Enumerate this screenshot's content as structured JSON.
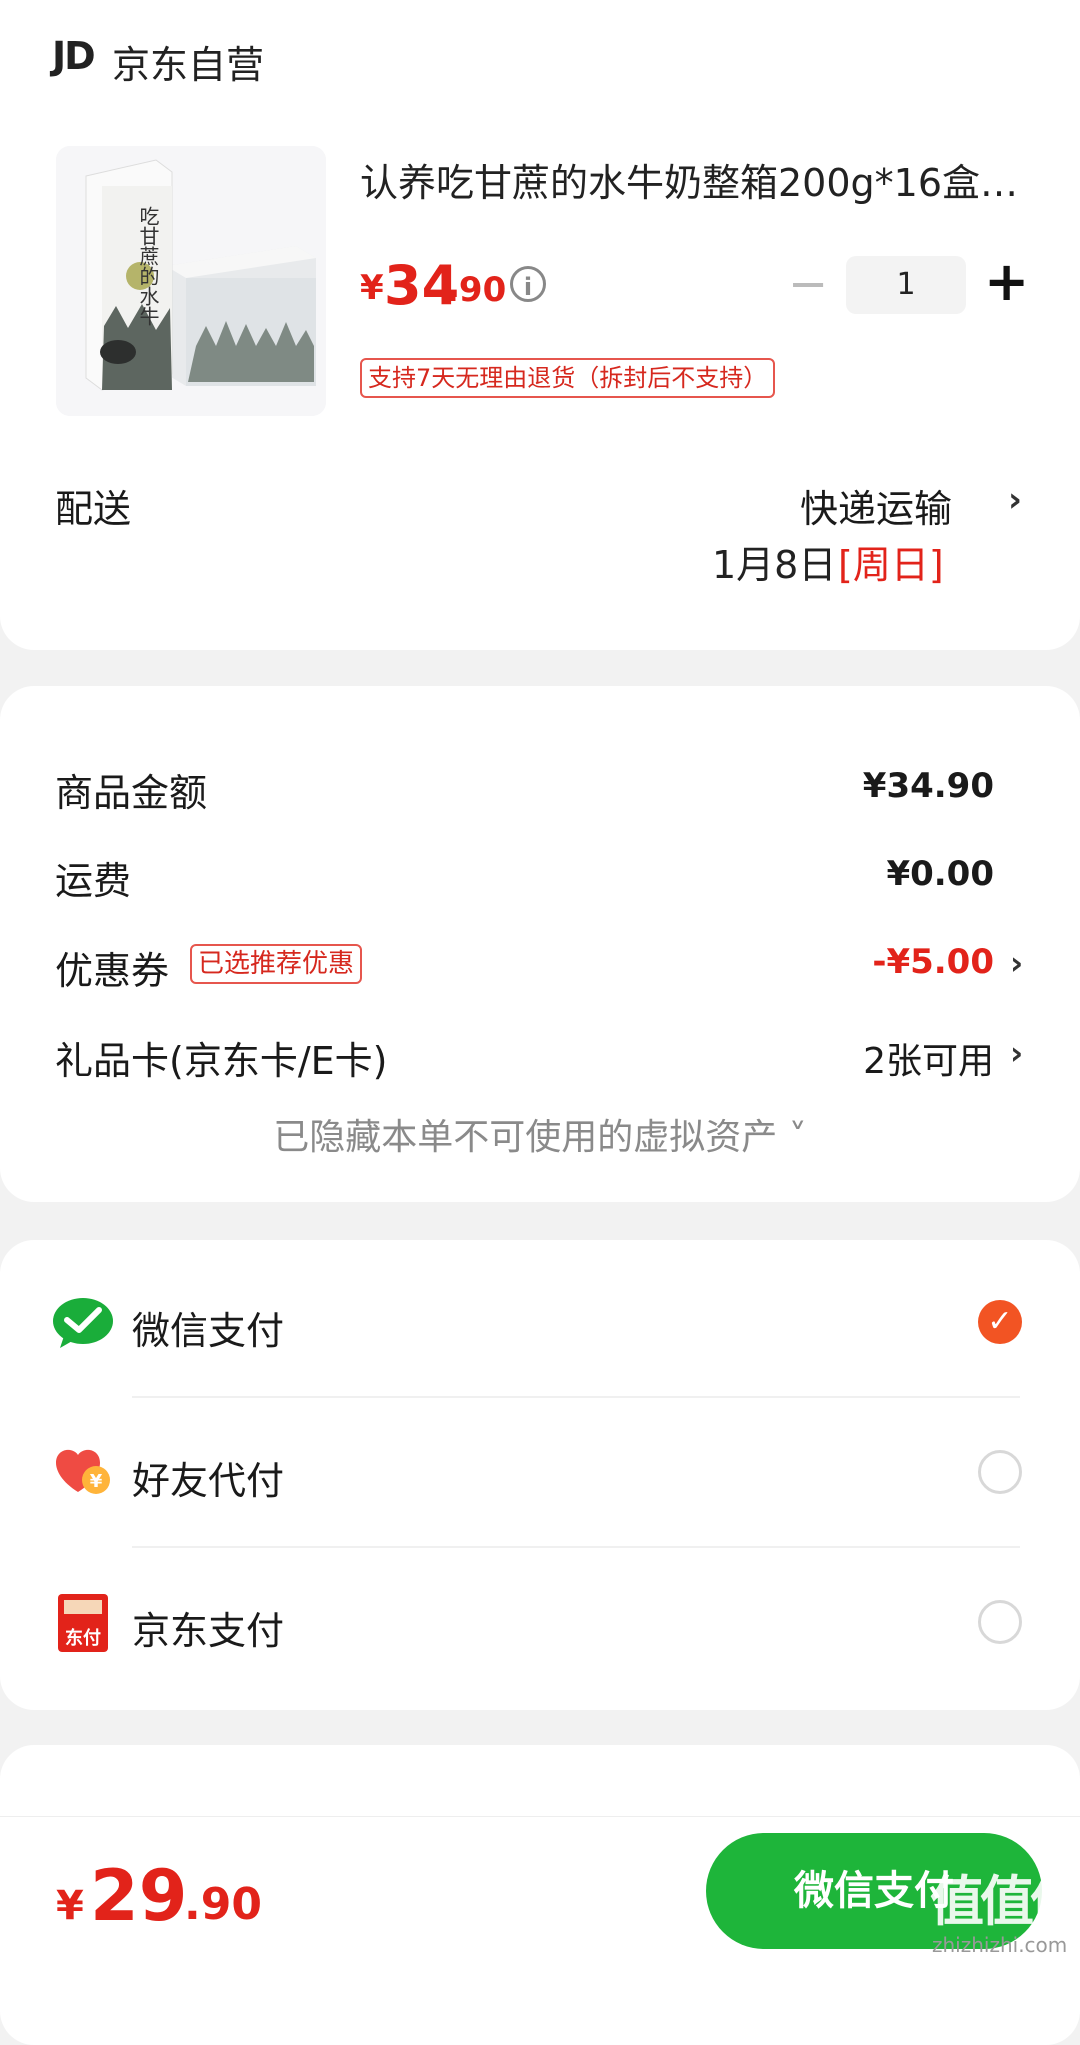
{
  "store": {
    "logo": "JD",
    "name": "京东自营"
  },
  "product": {
    "title": "认养吃甘蔗的水牛奶整箱200g*16盒…",
    "price_currency": "¥",
    "price_int": "34",
    "price_dec": ".90",
    "quantity": "1",
    "minus": "−",
    "plus": "+",
    "return_policy": "支持7天无理由退货（拆封后不支持）",
    "image_text": "吃甘蔗的水牛"
  },
  "delivery": {
    "label": "配送",
    "method": "快递运输",
    "date": "1月8日",
    "weekday": "[周日]"
  },
  "summary": {
    "rows": [
      {
        "label": "商品金额",
        "value": "¥34.90"
      },
      {
        "label": "运费",
        "value": "¥0.00"
      },
      {
        "label": "优惠券",
        "tag": "已选推荐优惠",
        "value": "-¥5.00"
      },
      {
        "label": "礼品卡(京东卡/E卡)",
        "value": "2张可用"
      }
    ],
    "hidden_note": "已隐藏本单不可使用的虚拟资产 ˅"
  },
  "payment": {
    "options": [
      {
        "label": "微信支付",
        "icon": "wechat-pay-icon",
        "selected": true
      },
      {
        "label": "好友代付",
        "icon": "heart-yen-icon",
        "selected": false
      },
      {
        "label": "京东支付",
        "icon": "jd-pay-icon",
        "icon_text": "东付",
        "selected": false
      }
    ]
  },
  "footer": {
    "total_currency": "¥",
    "total_int": "29",
    "total_dec": ".90",
    "pay_button": "微信支付",
    "watermark": "值值值",
    "watermark_url": "zhizhizhi.com"
  },
  "colors": {
    "price_red": "#e2231a",
    "wechat_green": "#1eb53a",
    "check_orange": "#f25423"
  }
}
